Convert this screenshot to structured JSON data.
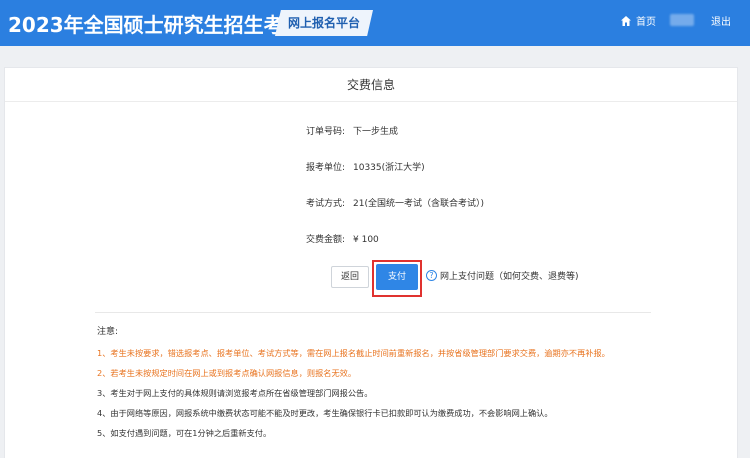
{
  "header": {
    "title": "2023年全国硕士研究生招生考试",
    "platform": "网上报名平台",
    "home": "首页",
    "logout": "退出"
  },
  "panel": {
    "title": "交费信息"
  },
  "fields": [
    {
      "label": "订单号码:",
      "value": "下一步生成"
    },
    {
      "label": "报考单位:",
      "value": "10335(浙江大学)"
    },
    {
      "label": "考试方式:",
      "value": "21(全国统一考试（含联合考试）)"
    },
    {
      "label": "交费金额:",
      "value": "¥ 100"
    }
  ],
  "buttons": {
    "back": "返回",
    "pay": "支付",
    "help": "网上支付问题（如何交费、退费等)"
  },
  "notes": {
    "title": "注意:",
    "items": [
      "1、考生未按要求，错选报考点、报考单位、考试方式等，需在网上报名截止时间前重新报名，并按省级管理部门要求交费，逾期亦不再补报。",
      "2、若考生未按规定时间在网上或到报考点确认网报信息，则报名无效。",
      "3、考生对于网上支付的具体规则请浏览报考点所在省级管理部门网报公告。",
      "4、由于网络等原因，网报系统中缴费状态可能不能及时更改，考生确保银行卡已扣款即可认为缴费成功，不会影响网上确认。",
      "5、如支付遇到问题，可在1分钟之后重新支付。"
    ]
  },
  "colors": {
    "header_bg": "#2b7fe0",
    "pay_button": "#2f86e6",
    "highlight": "#e0322f",
    "warning_text": "#e8731f"
  }
}
